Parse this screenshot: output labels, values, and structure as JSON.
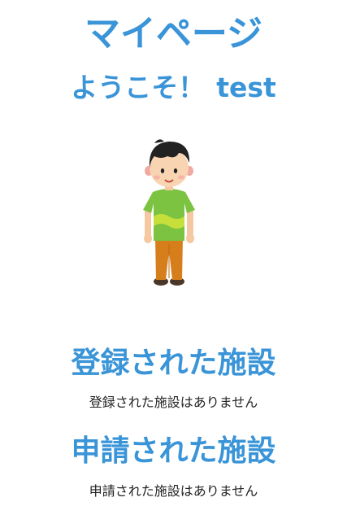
{
  "page": {
    "title": "マイページ",
    "welcome_prefix": "ようこそ！",
    "username": "test"
  },
  "sections": {
    "registered": {
      "heading": "登録された施設",
      "empty_message": "登録された施設はありません"
    },
    "applied": {
      "heading": "申請された施設",
      "empty_message": "申請された施設はありません"
    }
  },
  "colors": {
    "accent": "#3a94d8",
    "text": "#222222",
    "background": "#ffffff"
  },
  "icons": {
    "avatar": "boy-avatar-illustration"
  }
}
